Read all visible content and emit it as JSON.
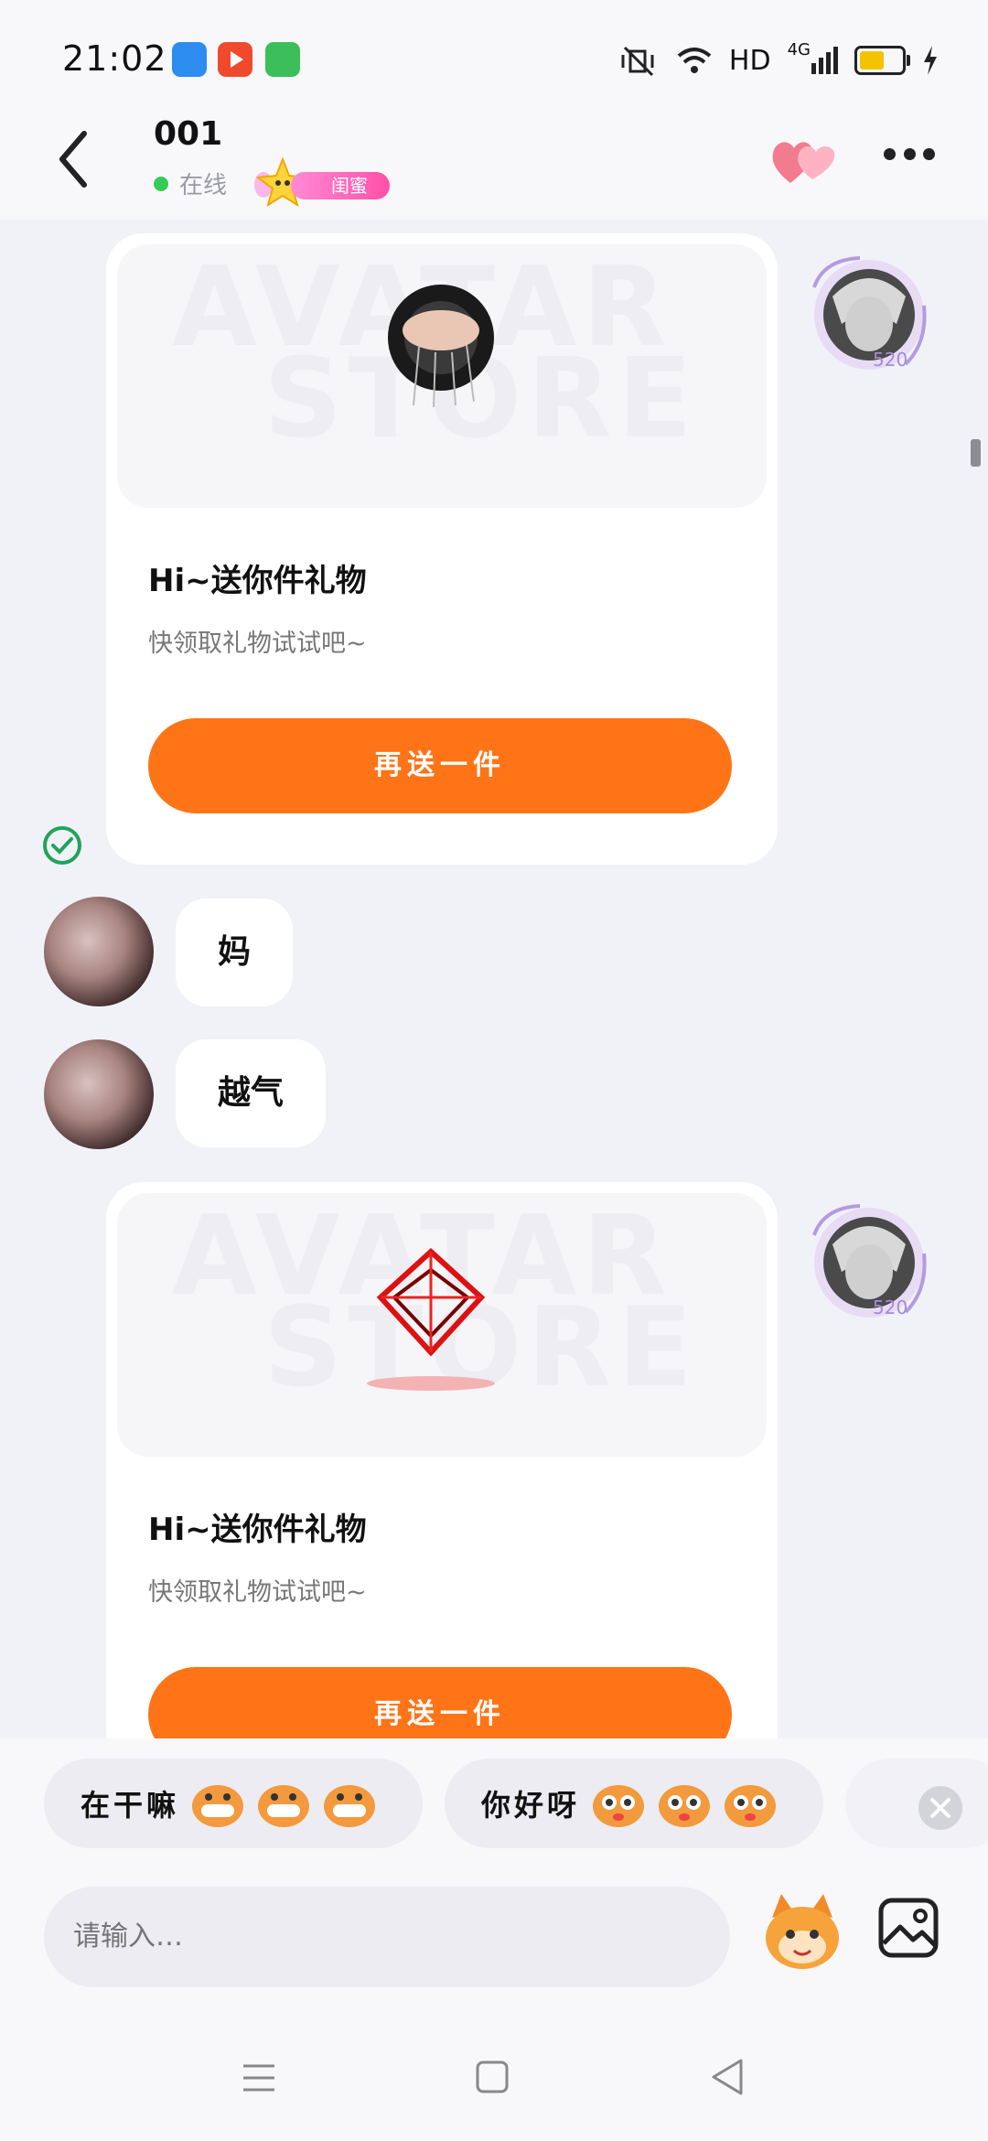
{
  "status_bar": {
    "time": "21:02",
    "network": "HD",
    "signal": "4G",
    "icons": [
      "app-blue-icon",
      "video-app-icon",
      "green-app-icon",
      "vibrate-mute-icon",
      "wifi-icon",
      "signal-icon",
      "battery-icon",
      "charging-icon"
    ]
  },
  "header": {
    "title": "001",
    "status": "在线",
    "badge_label": "闺蜜"
  },
  "messages": {
    "gift_card_1": {
      "watermark_1": "AVATAR",
      "watermark_2": "STORE",
      "title": "Hi~送你件礼物",
      "subtitle": "快领取礼物试试吧~",
      "button": "再送一件"
    },
    "bubble_1": "妈",
    "bubble_2": "越气",
    "gift_card_2": {
      "watermark_1": "AVATAR",
      "watermark_2": "STORE",
      "title": "Hi~送你件礼物",
      "subtitle": "快领取礼物试试吧~",
      "button": "再送一件"
    },
    "avatar_badge": "520"
  },
  "quick_replies": [
    {
      "text": "在干嘛"
    },
    {
      "text": "你好呀"
    }
  ],
  "input": {
    "placeholder": "请输入…"
  },
  "colors": {
    "accent": "#ff7417",
    "online": "#33cc55",
    "badge": "#ff4fa8",
    "background": "#f1f2f8"
  }
}
